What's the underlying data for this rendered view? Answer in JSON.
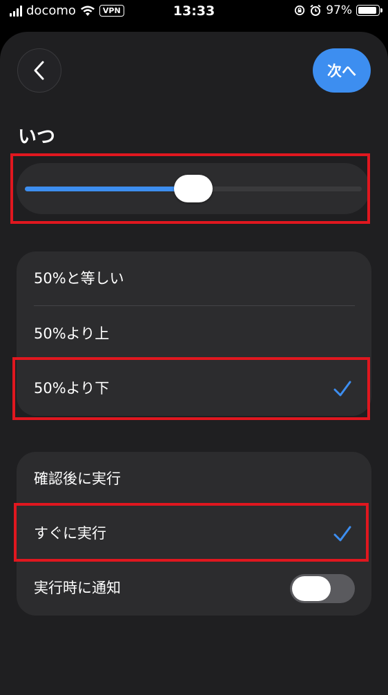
{
  "status_bar": {
    "carrier": "docomo",
    "vpn": "VPN",
    "time": "13:33",
    "battery": "97%",
    "battery_level": 0.97
  },
  "header": {
    "next_label": "次へ"
  },
  "section": {
    "title": "いつ"
  },
  "slider": {
    "value_percent": 50,
    "accent": "#3d8ef0"
  },
  "condition_options": [
    {
      "label": "50%と等しい",
      "selected": false
    },
    {
      "label": "50%より上",
      "selected": false
    },
    {
      "label": "50%より下",
      "selected": true
    }
  ],
  "run_options": [
    {
      "label": "確認後に実行",
      "selected": false
    },
    {
      "label": "すぐに実行",
      "selected": true
    }
  ],
  "notify": {
    "label": "実行時に通知",
    "on": false
  },
  "colors": {
    "accent": "#3d8ef0",
    "highlight": "#e0171f"
  }
}
